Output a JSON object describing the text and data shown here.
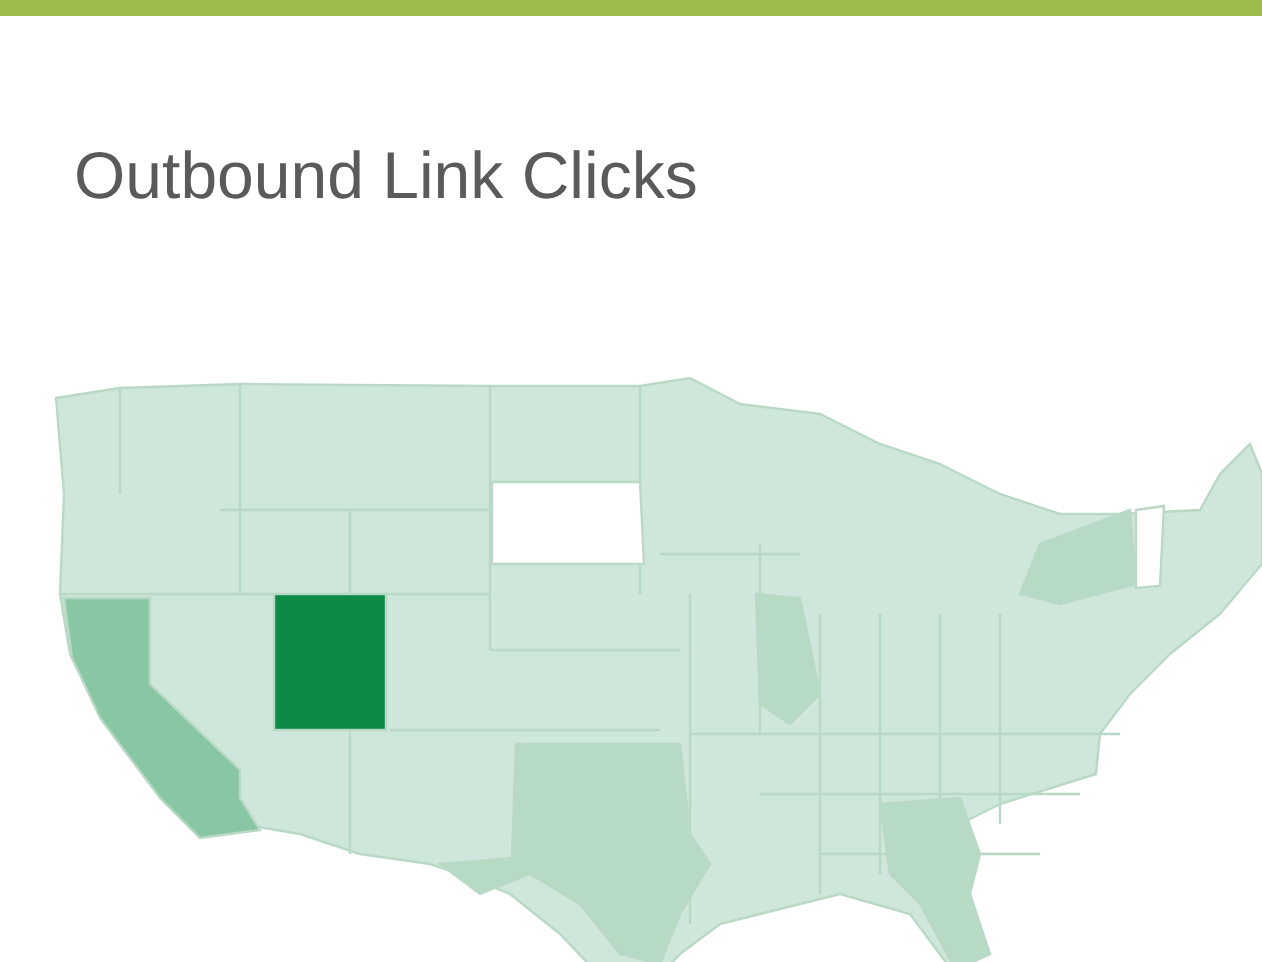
{
  "card": {
    "title": "Outbound Link Clicks"
  }
}
